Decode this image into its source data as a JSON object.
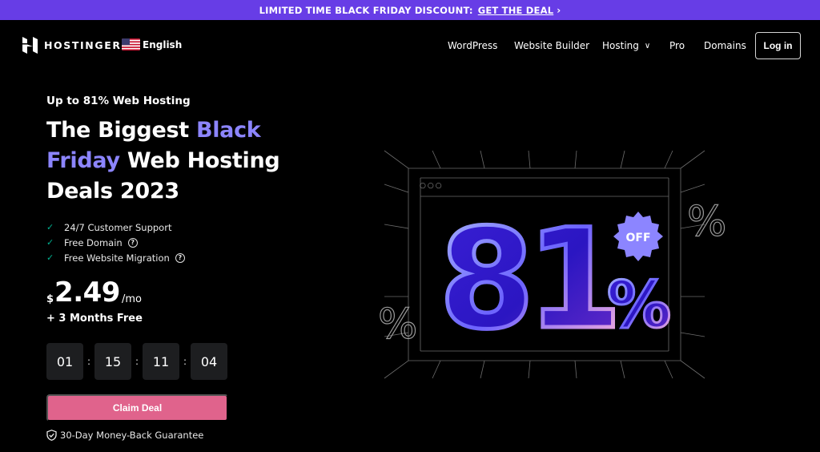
{
  "promo": {
    "text": "LIMITED TIME BLACK FRIDAY DISCOUNT:",
    "link": "GET THE DEAL",
    "chevron": "›"
  },
  "header": {
    "brand": "HOSTINGER",
    "language": "English",
    "flag_icon": "us-flag-icon",
    "nav": [
      {
        "label": "WordPress"
      },
      {
        "label": "Website Builder"
      },
      {
        "label": "Hosting",
        "dropdown": true
      },
      {
        "label": "Pro"
      },
      {
        "label": "Domains"
      }
    ],
    "login": "Log in"
  },
  "hero": {
    "subtitle": "Up to 81% Web Hosting",
    "title_part1": "The Biggest ",
    "title_accent1": "Black",
    "title_accent2": "Friday",
    "title_part2": " Web Hosting Deals 2023",
    "features": [
      {
        "label": "24/7 Customer Support",
        "help": false
      },
      {
        "label": "Free Domain",
        "help": true
      },
      {
        "label": "Free Website Migration",
        "help": true
      }
    ],
    "price": {
      "currency": "$",
      "amount": "2.49",
      "period": "/mo"
    },
    "bonus": "+ 3 Months Free",
    "countdown": [
      "01",
      "15",
      "11",
      "04"
    ],
    "countdown_sep": ":",
    "cta": "Claim Deal",
    "guarantee": "30-Day Money-Back Guarantee"
  },
  "illustration": {
    "big_number": "81",
    "big_percent": "%",
    "badge": "OFF",
    "side_percent": "%",
    "dots": "○○○"
  },
  "colors": {
    "promo_bg": "#673de6",
    "accent_text": "#8c85ff",
    "cta_bg": "#e0638c",
    "check": "#00b090",
    "badge": "#8c85ff",
    "timer_bg": "#1d1e20"
  }
}
